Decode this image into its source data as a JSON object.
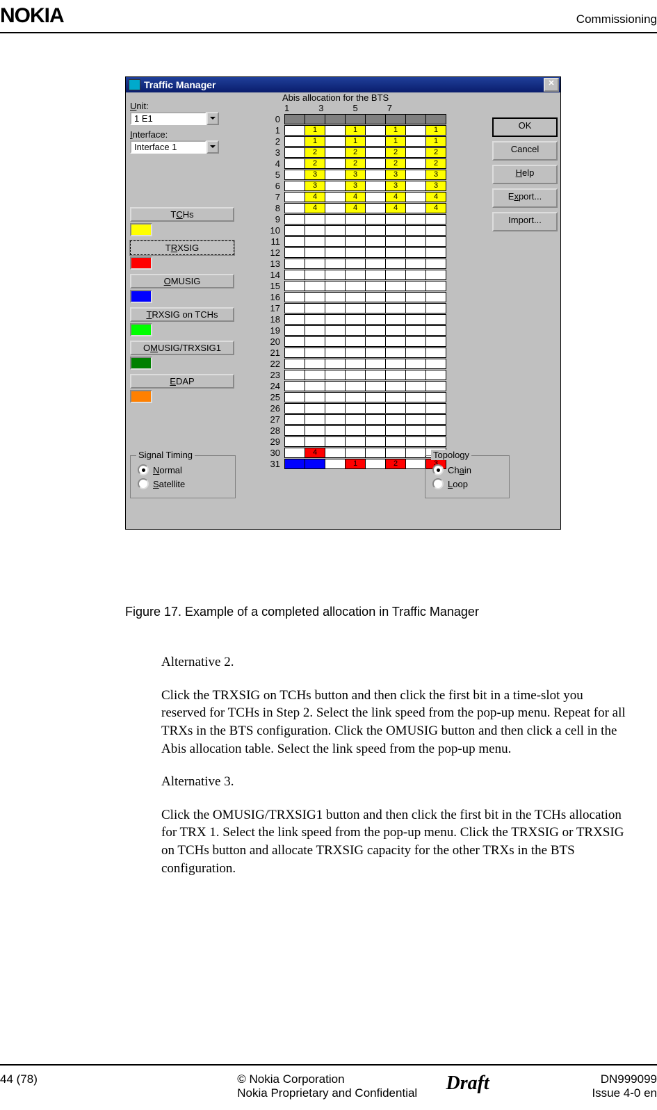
{
  "header": {
    "brand": "NOKIA",
    "section": "Commissioning"
  },
  "window": {
    "title": "Traffic Manager",
    "abis_title": "Abis allocation for the BTS",
    "top_cols": [
      "1",
      "3",
      "5",
      "7"
    ],
    "unit_label": "Unit:",
    "unit_value": "1 E1",
    "iface_label": "Interface:",
    "iface_value": "Interface 1",
    "legend": {
      "tchs": "TCHs",
      "trxsig": "TRXSIG",
      "omusig": "OMUSIG",
      "trxsig_tchs": "TRXSIG on TCHs",
      "omusig_trx": "OMUSIG/TRXSIG1",
      "edap": "EDAP"
    },
    "grid": [
      {
        "n": 0,
        "cells": [
          {
            "c": "g"
          },
          {
            "c": "g"
          },
          {
            "c": "g"
          },
          {
            "c": "g"
          },
          {
            "c": "g"
          },
          {
            "c": "g"
          },
          {
            "c": "g"
          },
          {
            "c": "g"
          }
        ]
      },
      {
        "n": 1,
        "cells": [
          {
            "c": "w"
          },
          {
            "c": "y",
            "v": "1"
          },
          {
            "c": "w"
          },
          {
            "c": "y",
            "v": "1"
          },
          {
            "c": "w"
          },
          {
            "c": "y",
            "v": "1"
          },
          {
            "c": "w"
          },
          {
            "c": "y",
            "v": "1"
          }
        ]
      },
      {
        "n": 2,
        "cells": [
          {
            "c": "w"
          },
          {
            "c": "y",
            "v": "1"
          },
          {
            "c": "w"
          },
          {
            "c": "y",
            "v": "1"
          },
          {
            "c": "w"
          },
          {
            "c": "y",
            "v": "1"
          },
          {
            "c": "w"
          },
          {
            "c": "y",
            "v": "1"
          }
        ]
      },
      {
        "n": 3,
        "cells": [
          {
            "c": "w"
          },
          {
            "c": "y",
            "v": "2"
          },
          {
            "c": "w"
          },
          {
            "c": "y",
            "v": "2"
          },
          {
            "c": "w"
          },
          {
            "c": "y",
            "v": "2"
          },
          {
            "c": "w"
          },
          {
            "c": "y",
            "v": "2"
          }
        ]
      },
      {
        "n": 4,
        "cells": [
          {
            "c": "w"
          },
          {
            "c": "y",
            "v": "2"
          },
          {
            "c": "w"
          },
          {
            "c": "y",
            "v": "2"
          },
          {
            "c": "w"
          },
          {
            "c": "y",
            "v": "2"
          },
          {
            "c": "w"
          },
          {
            "c": "y",
            "v": "2"
          }
        ]
      },
      {
        "n": 5,
        "cells": [
          {
            "c": "w"
          },
          {
            "c": "y",
            "v": "3"
          },
          {
            "c": "w"
          },
          {
            "c": "y",
            "v": "3"
          },
          {
            "c": "w"
          },
          {
            "c": "y",
            "v": "3"
          },
          {
            "c": "w"
          },
          {
            "c": "y",
            "v": "3"
          }
        ]
      },
      {
        "n": 6,
        "cells": [
          {
            "c": "w"
          },
          {
            "c": "y",
            "v": "3"
          },
          {
            "c": "w"
          },
          {
            "c": "y",
            "v": "3"
          },
          {
            "c": "w"
          },
          {
            "c": "y",
            "v": "3"
          },
          {
            "c": "w"
          },
          {
            "c": "y",
            "v": "3"
          }
        ]
      },
      {
        "n": 7,
        "cells": [
          {
            "c": "w"
          },
          {
            "c": "y",
            "v": "4"
          },
          {
            "c": "w"
          },
          {
            "c": "y",
            "v": "4"
          },
          {
            "c": "w"
          },
          {
            "c": "y",
            "v": "4"
          },
          {
            "c": "w"
          },
          {
            "c": "y",
            "v": "4"
          }
        ]
      },
      {
        "n": 8,
        "cells": [
          {
            "c": "w"
          },
          {
            "c": "y",
            "v": "4"
          },
          {
            "c": "w"
          },
          {
            "c": "y",
            "v": "4"
          },
          {
            "c": "w"
          },
          {
            "c": "y",
            "v": "4"
          },
          {
            "c": "w"
          },
          {
            "c": "y",
            "v": "4"
          }
        ]
      },
      {
        "n": 9,
        "cells": [
          {
            "c": "w"
          },
          {
            "c": "w"
          },
          {
            "c": "w"
          },
          {
            "c": "w"
          },
          {
            "c": "w"
          },
          {
            "c": "w"
          },
          {
            "c": "w"
          },
          {
            "c": "w"
          }
        ]
      },
      {
        "n": 10,
        "cells": [
          {
            "c": "w"
          },
          {
            "c": "w"
          },
          {
            "c": "w"
          },
          {
            "c": "w"
          },
          {
            "c": "w"
          },
          {
            "c": "w"
          },
          {
            "c": "w"
          },
          {
            "c": "w"
          }
        ]
      },
      {
        "n": 11,
        "cells": [
          {
            "c": "w"
          },
          {
            "c": "w"
          },
          {
            "c": "w"
          },
          {
            "c": "w"
          },
          {
            "c": "w"
          },
          {
            "c": "w"
          },
          {
            "c": "w"
          },
          {
            "c": "w"
          }
        ]
      },
      {
        "n": 12,
        "cells": [
          {
            "c": "w"
          },
          {
            "c": "w"
          },
          {
            "c": "w"
          },
          {
            "c": "w"
          },
          {
            "c": "w"
          },
          {
            "c": "w"
          },
          {
            "c": "w"
          },
          {
            "c": "w"
          }
        ]
      },
      {
        "n": 13,
        "cells": [
          {
            "c": "w"
          },
          {
            "c": "w"
          },
          {
            "c": "w"
          },
          {
            "c": "w"
          },
          {
            "c": "w"
          },
          {
            "c": "w"
          },
          {
            "c": "w"
          },
          {
            "c": "w"
          }
        ]
      },
      {
        "n": 14,
        "cells": [
          {
            "c": "w"
          },
          {
            "c": "w"
          },
          {
            "c": "w"
          },
          {
            "c": "w"
          },
          {
            "c": "w"
          },
          {
            "c": "w"
          },
          {
            "c": "w"
          },
          {
            "c": "w"
          }
        ]
      },
      {
        "n": 15,
        "cells": [
          {
            "c": "w"
          },
          {
            "c": "w"
          },
          {
            "c": "w"
          },
          {
            "c": "w"
          },
          {
            "c": "w"
          },
          {
            "c": "w"
          },
          {
            "c": "w"
          },
          {
            "c": "w"
          }
        ]
      },
      {
        "n": 16,
        "cells": [
          {
            "c": "w"
          },
          {
            "c": "w"
          },
          {
            "c": "w"
          },
          {
            "c": "w"
          },
          {
            "c": "w"
          },
          {
            "c": "w"
          },
          {
            "c": "w"
          },
          {
            "c": "w"
          }
        ]
      },
      {
        "n": 17,
        "cells": [
          {
            "c": "w"
          },
          {
            "c": "w"
          },
          {
            "c": "w"
          },
          {
            "c": "w"
          },
          {
            "c": "w"
          },
          {
            "c": "w"
          },
          {
            "c": "w"
          },
          {
            "c": "w"
          }
        ]
      },
      {
        "n": 18,
        "cells": [
          {
            "c": "w"
          },
          {
            "c": "w"
          },
          {
            "c": "w"
          },
          {
            "c": "w"
          },
          {
            "c": "w"
          },
          {
            "c": "w"
          },
          {
            "c": "w"
          },
          {
            "c": "w"
          }
        ]
      },
      {
        "n": 19,
        "cells": [
          {
            "c": "w"
          },
          {
            "c": "w"
          },
          {
            "c": "w"
          },
          {
            "c": "w"
          },
          {
            "c": "w"
          },
          {
            "c": "w"
          },
          {
            "c": "w"
          },
          {
            "c": "w"
          }
        ]
      },
      {
        "n": 20,
        "cells": [
          {
            "c": "w"
          },
          {
            "c": "w"
          },
          {
            "c": "w"
          },
          {
            "c": "w"
          },
          {
            "c": "w"
          },
          {
            "c": "w"
          },
          {
            "c": "w"
          },
          {
            "c": "w"
          }
        ]
      },
      {
        "n": 21,
        "cells": [
          {
            "c": "w"
          },
          {
            "c": "w"
          },
          {
            "c": "w"
          },
          {
            "c": "w"
          },
          {
            "c": "w"
          },
          {
            "c": "w"
          },
          {
            "c": "w"
          },
          {
            "c": "w"
          }
        ]
      },
      {
        "n": 22,
        "cells": [
          {
            "c": "w"
          },
          {
            "c": "w"
          },
          {
            "c": "w"
          },
          {
            "c": "w"
          },
          {
            "c": "w"
          },
          {
            "c": "w"
          },
          {
            "c": "w"
          },
          {
            "c": "w"
          }
        ]
      },
      {
        "n": 23,
        "cells": [
          {
            "c": "w"
          },
          {
            "c": "w"
          },
          {
            "c": "w"
          },
          {
            "c": "w"
          },
          {
            "c": "w"
          },
          {
            "c": "w"
          },
          {
            "c": "w"
          },
          {
            "c": "w"
          }
        ]
      },
      {
        "n": 24,
        "cells": [
          {
            "c": "w"
          },
          {
            "c": "w"
          },
          {
            "c": "w"
          },
          {
            "c": "w"
          },
          {
            "c": "w"
          },
          {
            "c": "w"
          },
          {
            "c": "w"
          },
          {
            "c": "w"
          }
        ]
      },
      {
        "n": 25,
        "cells": [
          {
            "c": "w"
          },
          {
            "c": "w"
          },
          {
            "c": "w"
          },
          {
            "c": "w"
          },
          {
            "c": "w"
          },
          {
            "c": "w"
          },
          {
            "c": "w"
          },
          {
            "c": "w"
          }
        ]
      },
      {
        "n": 26,
        "cells": [
          {
            "c": "w"
          },
          {
            "c": "w"
          },
          {
            "c": "w"
          },
          {
            "c": "w"
          },
          {
            "c": "w"
          },
          {
            "c": "w"
          },
          {
            "c": "w"
          },
          {
            "c": "w"
          }
        ]
      },
      {
        "n": 27,
        "cells": [
          {
            "c": "w"
          },
          {
            "c": "w"
          },
          {
            "c": "w"
          },
          {
            "c": "w"
          },
          {
            "c": "w"
          },
          {
            "c": "w"
          },
          {
            "c": "w"
          },
          {
            "c": "w"
          }
        ]
      },
      {
        "n": 28,
        "cells": [
          {
            "c": "w"
          },
          {
            "c": "w"
          },
          {
            "c": "w"
          },
          {
            "c": "w"
          },
          {
            "c": "w"
          },
          {
            "c": "w"
          },
          {
            "c": "w"
          },
          {
            "c": "w"
          }
        ]
      },
      {
        "n": 29,
        "cells": [
          {
            "c": "w"
          },
          {
            "c": "w"
          },
          {
            "c": "w"
          },
          {
            "c": "w"
          },
          {
            "c": "w"
          },
          {
            "c": "w"
          },
          {
            "c": "w"
          },
          {
            "c": "w"
          }
        ]
      },
      {
        "n": 30,
        "cells": [
          {
            "c": "w"
          },
          {
            "c": "r",
            "v": "4"
          },
          {
            "c": "w"
          },
          {
            "c": "w"
          },
          {
            "c": "w"
          },
          {
            "c": "w"
          },
          {
            "c": "w"
          },
          {
            "c": "w"
          }
        ]
      },
      {
        "n": 31,
        "cells": [
          {
            "c": "b"
          },
          {
            "c": "b"
          },
          {
            "c": "w"
          },
          {
            "c": "r",
            "v": "1"
          },
          {
            "c": "w"
          },
          {
            "c": "r",
            "v": "2"
          },
          {
            "c": "w"
          },
          {
            "c": "r",
            "v": "3"
          }
        ]
      }
    ],
    "buttons": {
      "ok": "OK",
      "cancel": "Cancel",
      "help": "Help",
      "export": "Export...",
      "import": "Import..."
    },
    "signal": {
      "title": "Signal Timing",
      "normal": "Normal",
      "satellite": "Satellite"
    },
    "topology": {
      "title": "Topology",
      "chain": "Chain",
      "loop": "Loop"
    }
  },
  "caption": "Figure 17.    Example of a completed allocation in Traffic Manager",
  "body": {
    "alt2h": "Alternative 2.",
    "alt2": "Click the TRXSIG on TCHs button and then click the first bit in a time-slot you reserved for TCHs in Step 2. Select the link speed from the pop-up menu. Repeat for all TRXs in the BTS configuration. Click the OMUSIG button and then click a cell in the Abis allocation table. Select the link speed from the pop-up menu.",
    "alt3h": "Alternative 3.",
    "alt3": "Click the OMUSIG/TRXSIG1 button and then click the first bit in the TCHs allocation for TRX 1. Select the link speed from the pop-up menu. Click the TRXSIG or TRXSIG on TCHs button and allocate TRXSIG capacity for the other TRXs in the BTS configuration."
  },
  "footer": {
    "pg": "44 (78)",
    "c1": "© Nokia Corporation",
    "c2": "Nokia Proprietary and Confidential",
    "draft": "Draft",
    "doc": "DN999099",
    "issue": "Issue 4-0 en"
  }
}
